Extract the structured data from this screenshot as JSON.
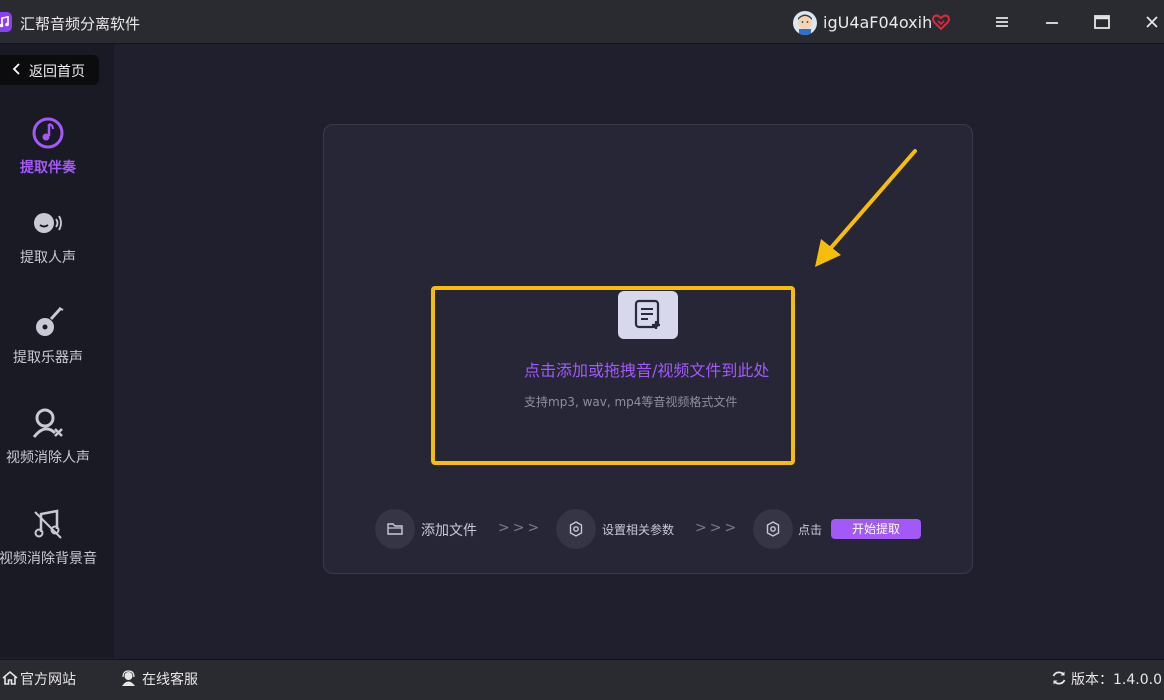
{
  "app": {
    "title": "汇帮音频分离软件"
  },
  "user": {
    "name": "igU4aF04oxih"
  },
  "sidebar": {
    "back_label": "返回首页",
    "items": [
      {
        "label": "提取伴奏",
        "icon": "music-note-icon",
        "active": true
      },
      {
        "label": "提取人声",
        "icon": "voice-icon",
        "active": false
      },
      {
        "label": "提取乐器声",
        "icon": "guitar-icon",
        "active": false
      },
      {
        "label": "视频消除人声",
        "icon": "person-remove-icon",
        "active": false
      },
      {
        "label": "视频消除背景音",
        "icon": "music-mute-icon",
        "active": false
      }
    ]
  },
  "dropzone": {
    "title": "点击添加或拖拽音/视频文件到此处",
    "subtitle": "支持mp3, wav, mp4等音视频格式文件"
  },
  "steps": {
    "step1": "添加文件",
    "arrow": ">>>",
    "step2": "设置相关参数",
    "step3": "点击",
    "start_button": "开始提取"
  },
  "footer": {
    "website": "官方网站",
    "support": "在线客服",
    "version": "版本：1.4.0.0"
  },
  "colors": {
    "accent": "#a259f7",
    "highlight": "#f6be0b",
    "background": "#1f1f2d"
  }
}
